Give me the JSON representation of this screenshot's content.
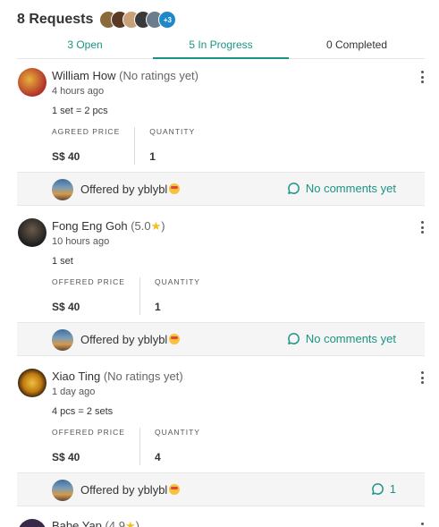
{
  "header": {
    "title": "8 Requests",
    "avatars": [
      {
        "color": "#8a6a3a"
      },
      {
        "color": "#5a3a24"
      },
      {
        "color": "#c9a27a"
      },
      {
        "color": "#3a3a3a"
      },
      {
        "color": "#6b7c8c"
      }
    ],
    "more_badge": "+3"
  },
  "tabs": [
    {
      "label": "3 Open"
    },
    {
      "label": "5 In Progress",
      "active": true
    },
    {
      "label": "0 Completed"
    }
  ],
  "requests": [
    {
      "name": "William How",
      "rating": "(No ratings yet)",
      "time": "4 hours ago",
      "set_text": "1 set = 2 pcs",
      "price_label": "AGREED PRICE",
      "price": "S$ 40",
      "quantity_label": "QUANTITY",
      "quantity": "1",
      "offered_by": "Offered by yblybl",
      "comments": "No comments yet",
      "avatar_color": "#b0302a"
    },
    {
      "name": "Fong Eng Goh",
      "rating_prefix": "(5.0",
      "rating_suffix": ")",
      "time": "10 hours ago",
      "set_text": "1 set",
      "price_label": "OFFERED PRICE",
      "price": "S$ 40",
      "quantity_label": "QUANTITY",
      "quantity": "1",
      "offered_by": "Offered by yblybl",
      "comments": "No comments yet",
      "avatar_color": "#2f2f2f"
    },
    {
      "name": "Xiao Ting",
      "rating": "(No ratings yet)",
      "time": "1 day ago",
      "set_text": "4 pcs = 2 sets",
      "price_label": "OFFERED PRICE",
      "price": "S$ 40",
      "quantity_label": "QUANTITY",
      "quantity": "4",
      "offered_by": "Offered by yblybl",
      "comments": "1",
      "avatar_color": "#d4a21a"
    }
  ],
  "peek": {
    "name": "Babe Yap",
    "rating_prefix": "(4.9",
    "rating_suffix": ")",
    "avatar_color": "#3a2a4a"
  },
  "colors": {
    "accent": "#1a9484",
    "star": "#f3c11b",
    "footer_bg": "#f5f5f5",
    "badge": "#1e88c8"
  }
}
